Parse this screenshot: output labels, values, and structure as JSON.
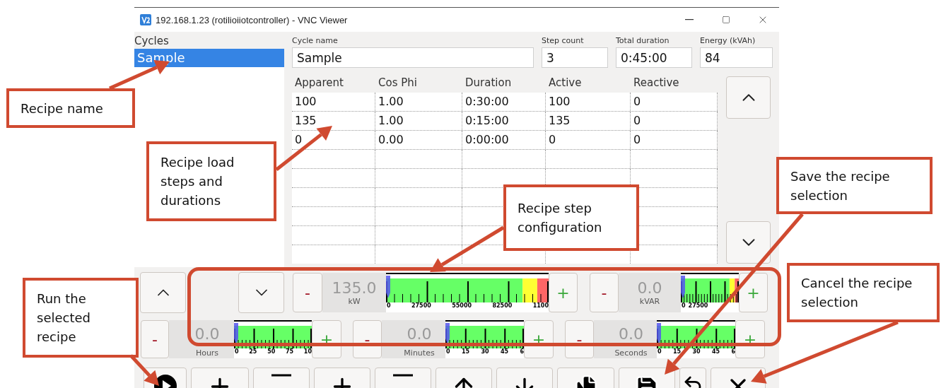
{
  "window": {
    "title": "192.168.1.23 (rotilioiiotcontroller) - VNC Viewer"
  },
  "cycles": {
    "label": "Cycles",
    "items": [
      {
        "name": "Sample",
        "selected": true
      }
    ]
  },
  "fields": [
    {
      "label": "Cycle name",
      "value": "Sample"
    },
    {
      "label": "Step count",
      "value": "3"
    },
    {
      "label": "Total duration",
      "value": "0:45:00"
    },
    {
      "label": "Energy (kVAh)",
      "value": "84"
    }
  ],
  "table": {
    "columns": [
      "Apparent",
      "Cos Phi",
      "Duration",
      "Active",
      "Reactive"
    ],
    "rows": [
      [
        "100",
        "1.00",
        "0:30:00",
        "100",
        "0"
      ],
      [
        "135",
        "1.00",
        "0:15:00",
        "135",
        "0"
      ],
      [
        "0",
        "0.00",
        "0:00:00",
        "0",
        "0"
      ]
    ]
  },
  "gauges": [
    {
      "kind": "power",
      "value": "135.0",
      "unit": "kW",
      "ticks": [
        "0",
        "27500",
        "55000",
        "82500",
        "1100"
      ]
    },
    {
      "kind": "power",
      "value": "0.0",
      "unit": "kVAR",
      "ticks": [
        "0",
        "27500"
      ]
    },
    {
      "kind": "time",
      "value": "0.0",
      "unit": "Hours",
      "ticks": [
        "0",
        "25",
        "50",
        "75",
        "10"
      ]
    },
    {
      "kind": "time",
      "value": "0.0",
      "unit": "Minutes",
      "ticks": [
        "0",
        "15",
        "30",
        "45",
        "6"
      ]
    },
    {
      "kind": "time",
      "value": "0.0",
      "unit": "Seconds",
      "ticks": [
        "0",
        "15",
        "30",
        "45",
        "6"
      ]
    }
  ],
  "gauge_sign": {
    "minus": "-",
    "plus": "+"
  },
  "actions": [
    {
      "kind": "run"
    },
    {
      "kind": "plus"
    },
    {
      "kind": "minus"
    },
    {
      "kind": "plus"
    },
    {
      "kind": "minus"
    },
    {
      "kind": "up"
    },
    {
      "kind": "down"
    },
    {
      "kind": "copy"
    },
    {
      "kind": "save"
    },
    {
      "kind": "undo"
    },
    {
      "kind": "cancel"
    }
  ],
  "annotations": [
    {
      "text": "Recipe name"
    },
    {
      "text": "Recipe load steps and durations"
    },
    {
      "text": "Recipe step configuration"
    },
    {
      "text": "Save the recipe selection"
    },
    {
      "text": "Cancel the recipe selection"
    },
    {
      "text": "Run the selected recipe"
    }
  ]
}
